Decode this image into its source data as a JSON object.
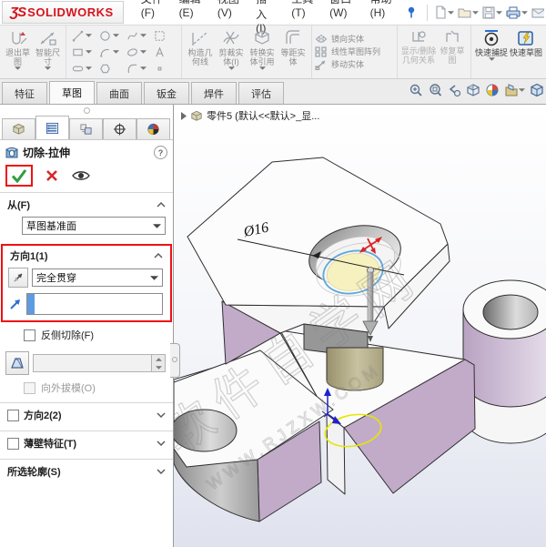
{
  "window": {
    "logo_mark": "ƷS",
    "logo_text": "SOLIDWORKS"
  },
  "menu": {
    "items": [
      "文件(F)",
      "编辑(E)",
      "视图(V)",
      "插入(I)",
      "工具(T)",
      "窗口(W)",
      "帮助(H)"
    ]
  },
  "commandbar": {
    "exit_sketch": "退出草图",
    "smart_dimension": "智能尺寸",
    "construction_line": "构造几何线",
    "trim_entities": "剪裁实体(I)",
    "convert_entities": "转换实体引用",
    "offset_entities": "等距实体",
    "mirror_entities": "镜向实体",
    "linear_pattern": "线性草图阵列",
    "move_entities": "移动实体",
    "display_delete_relations": "显示/删除几何关系",
    "repair_sketch": "修复草图",
    "quick_snaps": "快速捕捉",
    "rapid_sketch": "快速草图"
  },
  "tabs": {
    "items": [
      "特征",
      "草图",
      "曲面",
      "钣金",
      "焊件",
      "评估"
    ],
    "active": "草图"
  },
  "property_panel": {
    "title": "切除-拉伸",
    "help": "?",
    "from_label": "从(F)",
    "from_value": "草图基准面",
    "dir1_label": "方向1(1)",
    "dir1_end_condition": "完全贯穿",
    "flip_side_label": "反侧切除(F)",
    "draft_outward_label": "向外拔模(O)",
    "dir2_label": "方向2(2)",
    "thin_feature_label": "薄壁特征(T)",
    "selected_contours_label": "所选轮廓(S)"
  },
  "viewport": {
    "tree_item": "零件5 (默认<<默认>_显...",
    "dimension_label": "Ø16",
    "watermark_text": "软件自学网",
    "watermark_url": "WWW.RJZXW.COM"
  },
  "colors": {
    "annotation_red": "#ee1111",
    "lavender_face": "#c2abc9",
    "tan_peg": "#b9b28a",
    "preview_yellow": "#f6f1bf",
    "sketch_blue": "#5fa8d8",
    "highlight_yellow": "#e6e600",
    "triad_blue": "#2020cc",
    "logo_red": "#d6131c"
  }
}
